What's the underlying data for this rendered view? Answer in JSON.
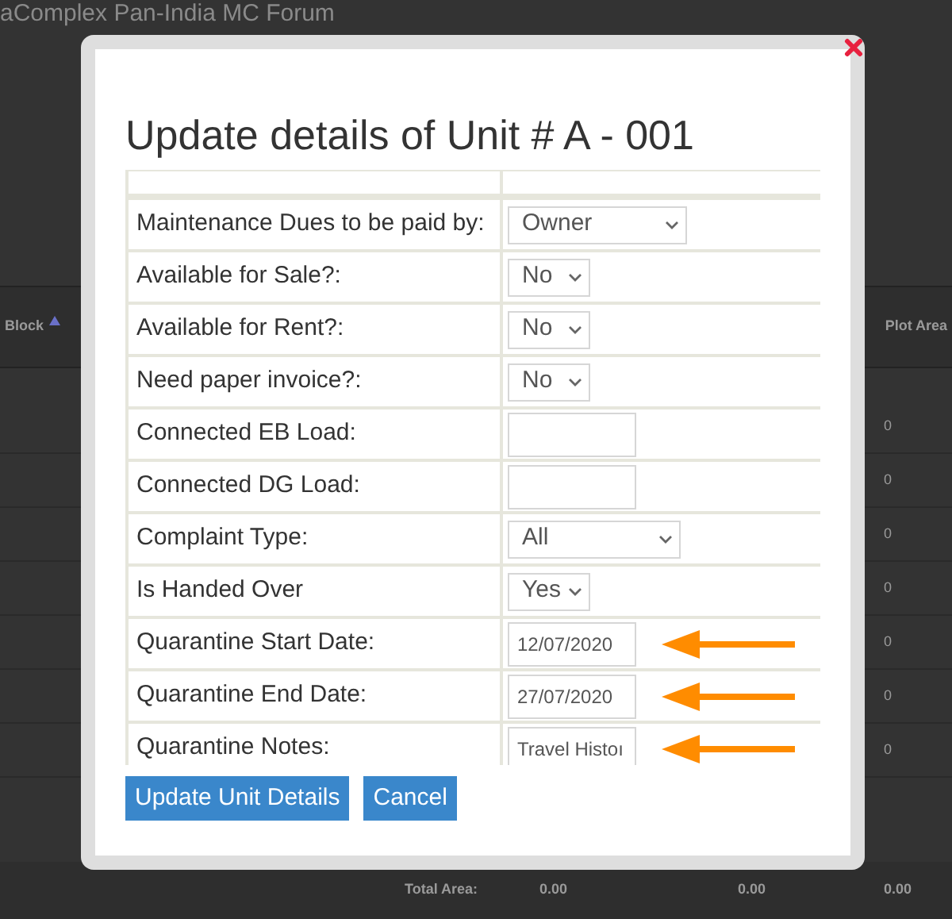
{
  "background": {
    "page_title": "aComplex Pan-India MC Forum",
    "columns": [
      {
        "label": "Block",
        "sorted": true
      },
      {
        "label": "Plot Area",
        "sorted": false
      }
    ],
    "rows": [
      "0",
      "0",
      "0",
      "0",
      "0",
      "0",
      "0"
    ],
    "totals": {
      "label": "Total Area:",
      "values": [
        "0.00",
        "0.00",
        "0.00"
      ]
    }
  },
  "dialog": {
    "title": "Update details of Unit # A - 001",
    "fields": [
      {
        "label": "Maintenance Dues to be paid by:",
        "kind": "select",
        "value": "Owner",
        "arrow": false
      },
      {
        "label": "Available for Sale?:",
        "kind": "select",
        "value": "No",
        "arrow": false
      },
      {
        "label": "Available for Rent?:",
        "kind": "select",
        "value": "No",
        "arrow": false
      },
      {
        "label": "Need paper invoice?:",
        "kind": "select",
        "value": "No",
        "arrow": false
      },
      {
        "label": "Connected EB Load:",
        "kind": "input",
        "arrow": false
      },
      {
        "label": "Connected DG Load:",
        "kind": "input",
        "arrow": false
      },
      {
        "label": "Complaint Type:",
        "kind": "select",
        "value": "All",
        "arrow": false
      },
      {
        "label": "Is Handed Over",
        "kind": "select",
        "value": "Yes",
        "arrow": false
      },
      {
        "label": "Quarantine Start Date:",
        "kind": "input",
        "value": "12/07/2020",
        "arrow": true
      },
      {
        "label": "Quarantine End Date:",
        "kind": "input",
        "value": "27/07/2020",
        "arrow": true
      },
      {
        "label": "Quarantine Notes:",
        "kind": "input",
        "value": "Travel Histoı",
        "arrow": true
      }
    ],
    "buttons": [
      "Update Unit Details",
      "Cancel"
    ]
  }
}
